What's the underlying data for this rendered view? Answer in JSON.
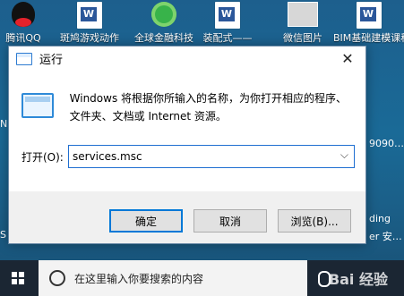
{
  "desktop": {
    "icons": [
      {
        "label": "腾讯QQ"
      },
      {
        "label": "斑鸠游戏动作"
      },
      {
        "label": "全球金融科技"
      },
      {
        "label": "装配式——"
      },
      {
        "label": "微信图片"
      },
      {
        "label": "BIM基础建模课程…"
      }
    ],
    "side_text": {
      "left_n1": "N",
      "left_s": "S",
      "right_top": "9090…",
      "right_mid": "ding",
      "right_bot": "er 安…"
    }
  },
  "dialog": {
    "title": "运行",
    "close_glyph": "✕",
    "message_line1": "Windows 将根据你所输入的名称，为你打开相应的程序、",
    "message_line2": "文件夹、文档或 Internet 资源。",
    "open_label": "打开(O):",
    "input_value": "services.msc",
    "dropdown_glyph": "⌵",
    "buttons": {
      "ok": "确定",
      "cancel": "取消",
      "browse": "浏览(B)..."
    }
  },
  "taskbar": {
    "search_placeholder": "在这里输入你要搜索的内容",
    "watermark": "Bai 经验"
  }
}
